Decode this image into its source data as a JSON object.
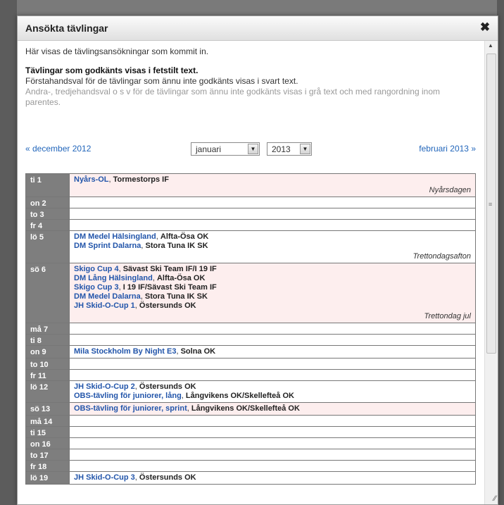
{
  "dialog": {
    "title": "Ansökta tävlingar",
    "close": "✖"
  },
  "intro": {
    "line1": "Här visas de tävlingsansökningar som kommit in.",
    "line2": "Tävlingar som godkänts visas i fetstilt text.",
    "line3": "Förstahandsval för de tävlingar som ännu inte godkänts visas i svart text.",
    "line4": "Andra-, tredjehandsval o s v för de tävlingar som ännu inte godkänts visas i grå text och med rangordning inom parentes."
  },
  "nav": {
    "prev": "« december 2012",
    "month": "januari",
    "year": "2013",
    "next": "februari 2013 »"
  },
  "calendar": [
    {
      "day": "ti 1",
      "events": [
        {
          "name": "Nyårs-OL",
          "org": "Tormestorps IF"
        }
      ],
      "holiday": "Nyårsdagen",
      "pink": true
    },
    {
      "day": "on 2",
      "events": []
    },
    {
      "day": "to 3",
      "events": []
    },
    {
      "day": "fr 4",
      "events": []
    },
    {
      "day": "lö 5",
      "events": [
        {
          "name": "DM Medel Hälsingland",
          "org": "Alfta-Ösa OK"
        },
        {
          "name": "DM Sprint Dalarna",
          "org": "Stora Tuna IK SK"
        }
      ],
      "holiday": "Trettondagsafton"
    },
    {
      "day": "sö 6",
      "events": [
        {
          "name": "Skigo Cup 4",
          "org": "Sävast Ski Team IF/I 19 IF"
        },
        {
          "name": "DM Lång Hälsingland",
          "org": "Alfta-Ösa OK"
        },
        {
          "name": "Skigo Cup 3",
          "org": "I 19 IF/Sävast Ski Team IF"
        },
        {
          "name": "DM Medel Dalarna",
          "org": "Stora Tuna IK SK"
        },
        {
          "name": "JH Skid-O-Cup 1",
          "org": "Östersunds OK"
        }
      ],
      "holiday": "Trettondag jul",
      "pink": true
    },
    {
      "day": "må 7",
      "events": []
    },
    {
      "day": "ti 8",
      "events": []
    },
    {
      "day": "on 9",
      "events": [
        {
          "name": "Mila Stockholm By Night E3",
          "org": "Solna OK"
        }
      ]
    },
    {
      "day": "to 10",
      "events": []
    },
    {
      "day": "fr 11",
      "events": []
    },
    {
      "day": "lö 12",
      "events": [
        {
          "name": "JH Skid-O-Cup 2",
          "org": "Östersunds OK"
        },
        {
          "name": "OBS-tävling för juniorer, lång",
          "org": "Långvikens OK/Skellefteå OK"
        }
      ]
    },
    {
      "day": "sö 13",
      "events": [
        {
          "name": "OBS-tävling för juniorer, sprint",
          "org": "Långvikens OK/Skellefteå OK"
        }
      ],
      "pink": true
    },
    {
      "day": "må 14",
      "events": []
    },
    {
      "day": "ti 15",
      "events": []
    },
    {
      "day": "on 16",
      "events": []
    },
    {
      "day": "to 17",
      "events": []
    },
    {
      "day": "fr 18",
      "events": []
    },
    {
      "day": "lö 19",
      "events": [
        {
          "name": "JH Skid-O-Cup 3",
          "org": "Östersunds OK"
        }
      ]
    }
  ]
}
